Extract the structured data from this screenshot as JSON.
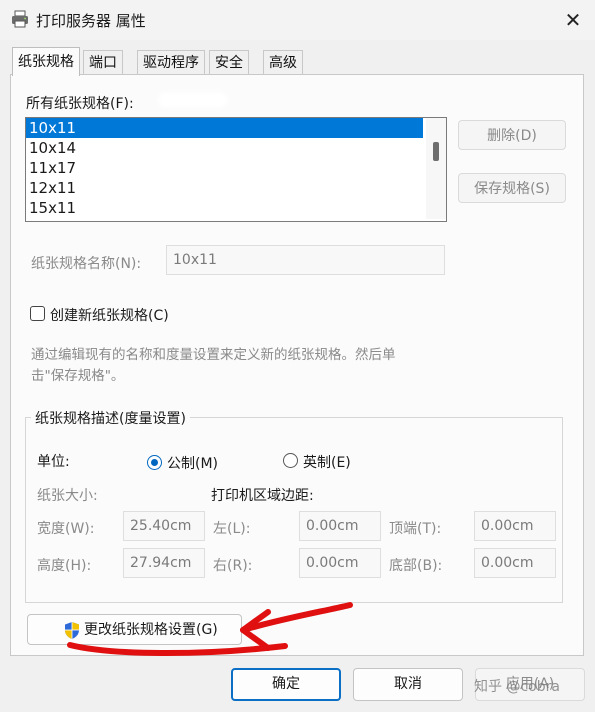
{
  "window": {
    "title": "打印服务器 属性",
    "close": "✕"
  },
  "tabs": [
    "纸张规格",
    "端口",
    "驱动程序",
    "安全",
    "高级"
  ],
  "forms": {
    "all_label": "所有纸张规格(F):",
    "items": [
      "10x11",
      "10x14",
      "11x17",
      "12x11",
      "15x11"
    ],
    "selected_index": 0,
    "delete_label": "删除(D)",
    "save_label": "保存规格(S)"
  },
  "form_name": {
    "label": "纸张规格名称(N):",
    "value": "10x11"
  },
  "create_new": {
    "label": "创建新纸张规格(C)",
    "checked": false
  },
  "hint": {
    "line1": "通过编辑现有的名称和度量设置来定义新的纸张规格。然后单",
    "line2": "击\"保存规格\"。"
  },
  "description": {
    "title": "纸张规格描述(度量设置)",
    "unit_label": "单位:",
    "metric_label": "公制(M)",
    "english_label": "英制(E)",
    "selected_unit": "metric",
    "size_label": "纸张大小:",
    "margins_label": "打印机区域边距:",
    "width_label": "宽度(W):",
    "width_value": "25.40cm",
    "height_label": "高度(H):",
    "height_value": "27.94cm",
    "left_label": "左(L):",
    "left_value": "0.00cm",
    "right_label": "右(R):",
    "right_value": "0.00cm",
    "top_label": "顶端(T):",
    "top_value": "0.00cm",
    "bottom_label": "底部(B):",
    "bottom_value": "0.00cm"
  },
  "change_settings": {
    "label": "更改纸张规格设置(G)",
    "icon": "uac-shield-icon"
  },
  "footer": {
    "ok": "确定",
    "cancel": "取消",
    "apply": "应用(A)"
  },
  "watermark": "知乎 @cobra",
  "colors": {
    "accent": "#0078d7",
    "annotation": "#e01010"
  }
}
